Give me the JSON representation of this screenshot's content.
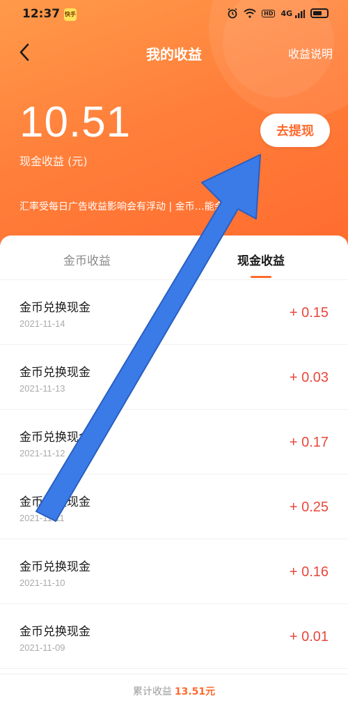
{
  "status": {
    "time": "12:37",
    "app_badge": "快手",
    "icons": [
      "alarm-icon",
      "wifi-icon",
      "hd-icon",
      "signal-icon",
      "battery-icon"
    ],
    "hd": "HD",
    "signal": "4G"
  },
  "nav": {
    "title": "我的收益",
    "help": "收益说明"
  },
  "summary": {
    "amount": "10.51",
    "amount_label": "现金收益 (元)",
    "withdraw": "去提现",
    "notice": "汇率受每日广告收益影响会有浮动 | 金币…能会有延迟"
  },
  "tabs": {
    "coin": "金币收益",
    "cash": "现金收益"
  },
  "records": [
    {
      "name": "金币兑换现金",
      "date": "2021-11-14",
      "value": "+ 0.15"
    },
    {
      "name": "金币兑换现金",
      "date": "2021-11-13",
      "value": "+ 0.03"
    },
    {
      "name": "金币兑换现金",
      "date": "2021-11-12",
      "value": "+ 0.17"
    },
    {
      "name": "金币兑换现金",
      "date": "2021-11-11",
      "value": "+ 0.25"
    },
    {
      "name": "金币兑换现金",
      "date": "2021-11-10",
      "value": "+ 0.16"
    },
    {
      "name": "金币兑换现金",
      "date": "2021-11-09",
      "value": "+ 0.01"
    }
  ],
  "footer": {
    "label": "累计收益",
    "total": "13.51元"
  },
  "colors": {
    "accent": "#ff6a2e",
    "positive": "#e8473b",
    "annotation_arrow": "#3a7be8"
  }
}
